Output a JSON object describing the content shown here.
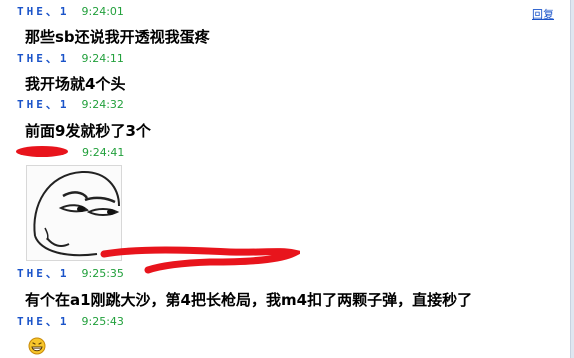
{
  "reply_link": "回复",
  "messages": [
    {
      "sender": "THE、1",
      "time": "9:24:01",
      "text": "那些sb还说我开透视我蛋疼"
    },
    {
      "sender": "THE、1",
      "time": "9:24:11",
      "text": "我开场就4个头"
    },
    {
      "sender": "THE、1",
      "time": "9:24:32",
      "text": "前面9发就秒了3个"
    },
    {
      "sender": "",
      "time": "9:24:41",
      "text": ""
    },
    {
      "sender": "THE、1",
      "time": "9:25:35",
      "text": "有个在a1刚跳大沙，第4把长枪局，我m4扣了两颗子弹，直接秒了"
    },
    {
      "sender": "THE、1",
      "time": "9:25:43",
      "text": ""
    }
  ],
  "icons": {
    "meme": "smirk-face-meme-icon",
    "emoji": "grinning-face-icon",
    "redaction": "red-scribble-redaction"
  },
  "colors": {
    "sender": "#1a53c9",
    "time": "#22a03c",
    "redaction": "#e8141c"
  }
}
